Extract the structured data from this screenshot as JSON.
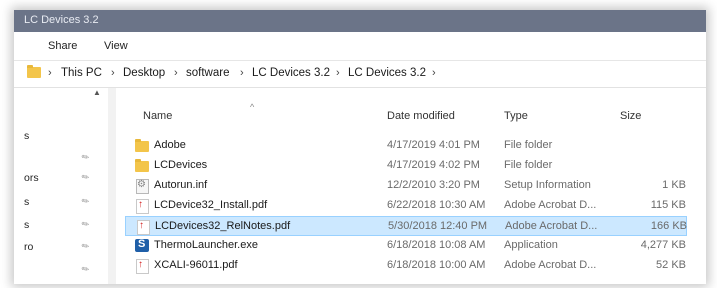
{
  "window": {
    "title": "LC Devices 3.2"
  },
  "ribbon": {
    "tabs": [
      "Share",
      "View"
    ]
  },
  "address": {
    "crumbs": [
      "This PC",
      "Desktop",
      "software",
      "LC Devices 3.2",
      "LC Devices 3.2"
    ]
  },
  "nav": {
    "items": [
      "s",
      "ors",
      "s",
      "s",
      "ro"
    ]
  },
  "columns": {
    "name": "Name",
    "date": "Date modified",
    "type": "Type",
    "size": "Size"
  },
  "files": [
    {
      "name": "Adobe",
      "date": "4/17/2019 4:01 PM",
      "type": "File folder",
      "size": "",
      "icon": "folder-icon"
    },
    {
      "name": "LCDevices",
      "date": "4/17/2019 4:02 PM",
      "type": "File folder",
      "size": "",
      "icon": "folder-icon"
    },
    {
      "name": "Autorun.inf",
      "date": "12/2/2010 3:20 PM",
      "type": "Setup Information",
      "size": "1 KB",
      "icon": "setup-file-icon"
    },
    {
      "name": "LCDevice32_Install.pdf",
      "date": "6/22/2018 10:30 AM",
      "type": "Adobe Acrobat D...",
      "size": "115 KB",
      "icon": "pdf-icon"
    },
    {
      "name": "LCDevices32_RelNotes.pdf",
      "date": "5/30/2018 12:40 PM",
      "type": "Adobe Acrobat D...",
      "size": "166 KB",
      "icon": "pdf-icon",
      "selected": true
    },
    {
      "name": "ThermoLauncher.exe",
      "date": "6/18/2018 10:08 AM",
      "type": "Application",
      "size": "4,277 KB",
      "icon": "app-icon"
    },
    {
      "name": "XCALI-96011.pdf",
      "date": "6/18/2018 10:00 AM",
      "type": "Adobe Acrobat D...",
      "size": "52 KB",
      "icon": "pdf-icon"
    }
  ],
  "colors": {
    "titlebar": "#6b7488",
    "selection": "#cce8ff",
    "folder": "#f3c54a"
  }
}
